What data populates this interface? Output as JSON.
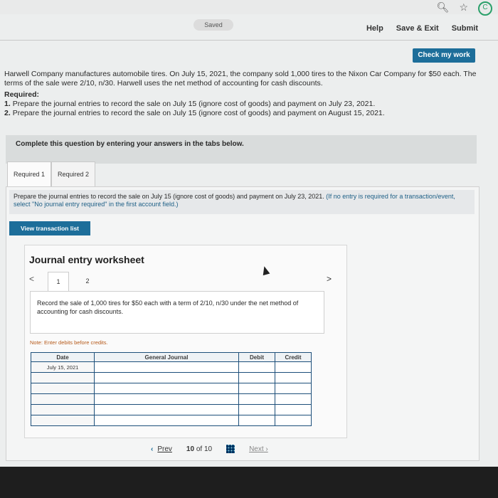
{
  "browser": {
    "url_fragment": "…ment/connect.html…",
    "search_icon": "search-icon",
    "star_icon": "star-icon",
    "ext_icon": "extension-icon"
  },
  "header": {
    "saved_label": "Saved",
    "help": "Help",
    "save_exit": "Save & Exit",
    "submit": "Submit",
    "check_my_work": "Check my work"
  },
  "problem": {
    "intro": "Harwell Company manufactures automobile tires. On July 15, 2021, the company sold 1,000 tires to the Nixon Car Company for $50 each. The terms of the sale were 2/10, n/30. Harwell uses the net method of accounting for cash discounts.",
    "required_heading": "Required:",
    "req1_num": "1.",
    "req1": "Prepare the journal entries to record the sale on July 15 (ignore cost of goods) and payment on July 23, 2021.",
    "req2_num": "2.",
    "req2": "Prepare the journal entries to record the sale on July 15 (ignore cost of goods) and payment on August 15, 2021."
  },
  "complete_bar": "Complete this question by entering your answers in the tabs below.",
  "tabs": [
    {
      "label": "Required 1"
    },
    {
      "label": "Required 2"
    }
  ],
  "instruction": {
    "main": "Prepare the journal entries to record the sale on July 15 (ignore cost of goods) and payment on July 23, 2021.",
    "note": "(If no entry is required for a transaction/event, select \"No journal entry required\" in the first account field.)"
  },
  "view_transaction_list": "View transaction list",
  "worksheet": {
    "title": "Journal entry worksheet",
    "prev_arrow": "<",
    "next_arrow": ">",
    "tabs": [
      "1",
      "2"
    ],
    "description": "Record the sale of 1,000 tires for $50 each with a term of 2/10, n/30 under the net method of accounting for cash discounts.",
    "note": "Note: Enter debits before credits.",
    "columns": {
      "date": "Date",
      "journal": "General Journal",
      "debit": "Debit",
      "credit": "Credit"
    },
    "rows": [
      {
        "date": "July 15, 2021",
        "account": "",
        "debit": "",
        "credit": ""
      },
      {
        "date": "",
        "account": "",
        "debit": "",
        "credit": ""
      },
      {
        "date": "",
        "account": "",
        "debit": "",
        "credit": ""
      },
      {
        "date": "",
        "account": "",
        "debit": "",
        "credit": ""
      },
      {
        "date": "",
        "account": "",
        "debit": "",
        "credit": ""
      },
      {
        "date": "",
        "account": "",
        "debit": "",
        "credit": ""
      }
    ]
  },
  "pager": {
    "prev": "Prev",
    "current": "10",
    "of": "of",
    "total": "10",
    "next": "Next"
  }
}
